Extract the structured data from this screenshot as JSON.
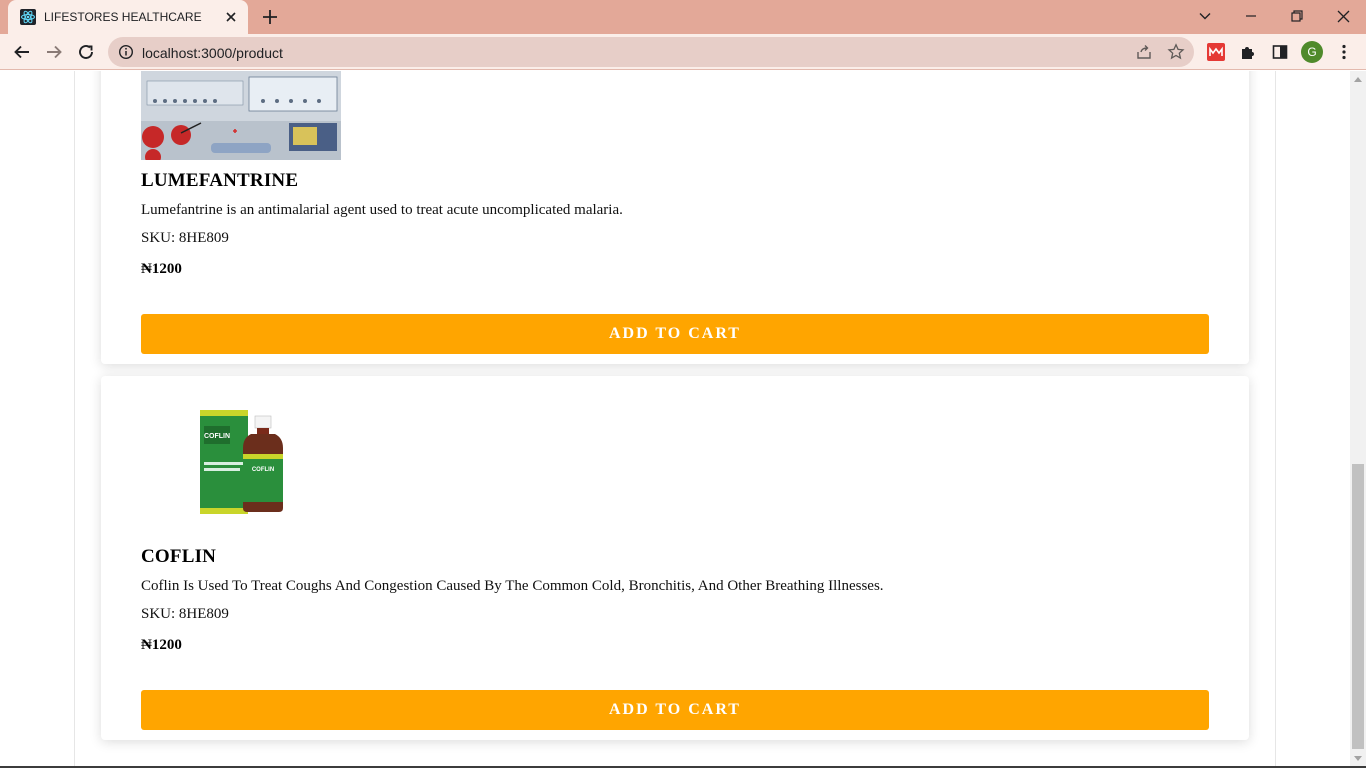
{
  "browser": {
    "tab_title": "LIFESTORES HEALTHCARE",
    "url": "localhost:3000/product",
    "profile_initial": "G",
    "colors": {
      "tabbar": "#e3a898",
      "toolbar": "#fbeee9",
      "omnibox": "#e7cec8"
    },
    "icons": [
      "react-icon",
      "close-icon",
      "plus-icon",
      "chevron-down-icon",
      "minimize-icon",
      "restore-icon",
      "close-window-icon",
      "back-icon",
      "forward-icon",
      "reload-icon",
      "info-icon",
      "share-icon",
      "star-icon",
      "extension-icon",
      "puzzle-icon",
      "sidepanel-icon",
      "kebab-menu-icon"
    ]
  },
  "products": [
    {
      "name": "LUMEFANTRINE",
      "description": "Lumefantrine is an antimalarial agent used to treat acute uncomplicated malaria.",
      "sku": "SKU: 8HE809",
      "price": "₦1200",
      "button": "ADD TO CART"
    },
    {
      "name": "COFLIN",
      "description": "Coflin Is Used To Treat Coughs And Congestion Caused By The Common Cold, Bronchitis, And Other Breathing Illnesses.",
      "sku": "SKU: 8HE809",
      "price": "₦1200",
      "button": "ADD TO CART",
      "image_text": "COFLIN"
    }
  ],
  "colors": {
    "accent": "#ffa500"
  }
}
